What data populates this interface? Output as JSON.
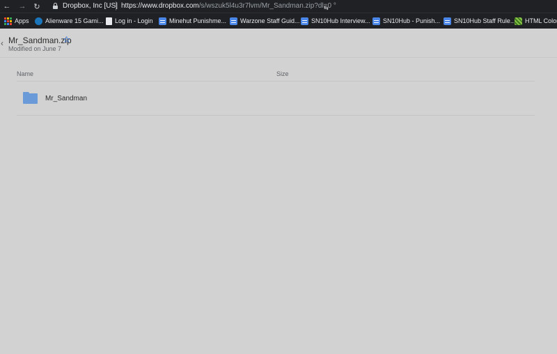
{
  "browser": {
    "back_glyph": "←",
    "forward_glyph": "→",
    "reload_glyph": "↻",
    "site_identity": "Dropbox, Inc [US]",
    "url_host": "https://www.dropbox.com",
    "url_path": "/s/wszuk5l4u3r7lvm/Mr_Sandman.zip?dl=0",
    "url_trailing": " °",
    "cursor_glyph": "⇆",
    "icons": [
      "back-arrow-icon",
      "forward-arrow-icon",
      "reload-icon",
      "lock-icon"
    ]
  },
  "bookmarks": [
    {
      "label": "Apps",
      "icon": "apps-grid-icon"
    },
    {
      "label": "Alienware 15 Gami...",
      "icon": "alienware-icon"
    },
    {
      "label": "Log in - Login",
      "icon": "page-icon"
    },
    {
      "label": "Minehut Punishme...",
      "icon": "docs-icon"
    },
    {
      "label": "Warzone Staff Guid...",
      "icon": "docs-icon"
    },
    {
      "label": "SN10Hub Interview...",
      "icon": "docs-icon"
    },
    {
      "label": "SN10Hub - Punish...",
      "icon": "docs-icon"
    },
    {
      "label": "SN10Hub Staff Rule...",
      "icon": "docs-icon"
    },
    {
      "label": "HTML Color Pi",
      "icon": "color-picker-icon"
    }
  ],
  "header": {
    "back_glyph": "‹",
    "title": "Mr_Sandman.zip",
    "star_glyph": "☆",
    "modified": "Modified on June 7"
  },
  "table": {
    "columns": [
      "Name",
      "Size"
    ],
    "rows": [
      {
        "name": "Mr_Sandman",
        "size": "",
        "icon": "folder-icon"
      }
    ]
  },
  "colors": {
    "accent": "#0061fe",
    "folder": "#6a9bd8",
    "overlay_bg": "#d2d2d2"
  }
}
